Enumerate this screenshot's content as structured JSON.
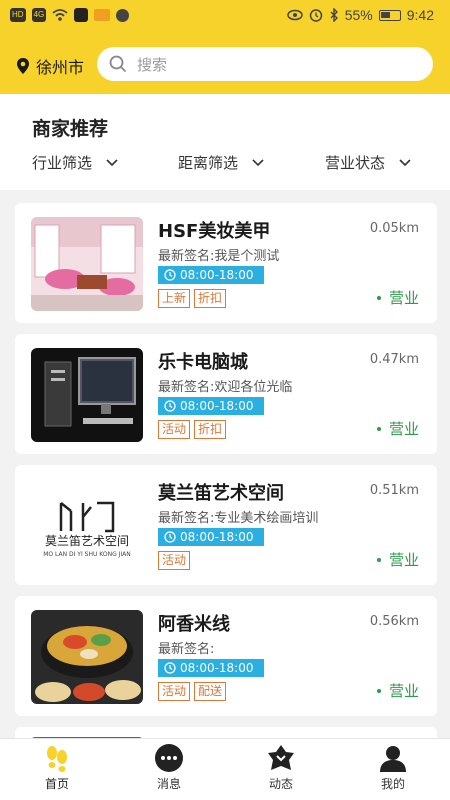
{
  "status_bar": {
    "left_icons": [
      "HD",
      "4G",
      "wifi-icon",
      "tiktok-icon",
      "mail-icon",
      "chat-icon"
    ],
    "right_icons": [
      "eye-icon",
      "alarm-icon",
      "bluetooth-icon"
    ],
    "battery": "55%",
    "time": "9:42"
  },
  "header": {
    "city": "徐州市",
    "search_placeholder": "搜索"
  },
  "recommend": {
    "title": "商家推荐",
    "filters": [
      {
        "label": "行业筛选"
      },
      {
        "label": "距离筛选"
      },
      {
        "label": "营业状态"
      }
    ]
  },
  "merchants": [
    {
      "name": "HSF美妆美甲",
      "distance": "0.05km",
      "signature": "最新签名:我是个测试",
      "hours": "08:00-18:00",
      "tags": [
        "上新",
        "折扣"
      ],
      "status": "营业",
      "thumb": "salon"
    },
    {
      "name": "乐卡电脑城",
      "distance": "0.47km",
      "signature": "最新签名:欢迎各位光临",
      "hours": "08:00-18:00",
      "tags": [
        "活动",
        "折扣"
      ],
      "status": "营业",
      "thumb": "computer"
    },
    {
      "name": "莫兰笛艺术空间",
      "distance": "0.51km",
      "signature": "最新签名:专业美术绘画培训",
      "hours": "08:00-18:00",
      "tags": [
        "活动"
      ],
      "status": "营业",
      "thumb": "logo",
      "logo_text": "莫兰笛艺术空间",
      "logo_subtext": "MO LAN DI YI SHU KONG JIAN"
    },
    {
      "name": "阿香米线",
      "distance": "0.56km",
      "signature": "最新签名:",
      "hours": "08:00-18:00",
      "tags": [
        "活动",
        "配送"
      ],
      "status": "营业",
      "thumb": "food"
    }
  ],
  "tab_bar": [
    {
      "label": "首页",
      "icon": "footprint-icon",
      "active": true
    },
    {
      "label": "消息",
      "icon": "message-icon",
      "active": false
    },
    {
      "label": "动态",
      "icon": "dynamic-icon",
      "active": false
    },
    {
      "label": "我的",
      "icon": "profile-icon",
      "active": false
    }
  ],
  "colors": {
    "accent": "#f6d22b",
    "hours_bg": "#2baee0",
    "tag": "#d6793a",
    "open": "#2d9a4c"
  }
}
